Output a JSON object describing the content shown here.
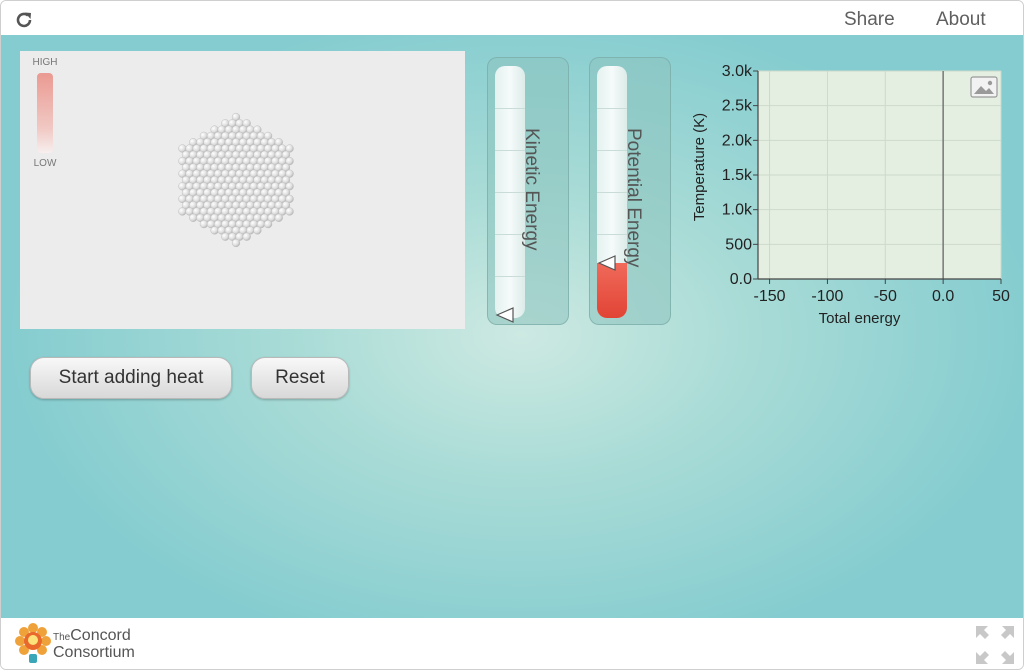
{
  "toolbar": {
    "reload_icon": "reload-icon",
    "share_label": "Share",
    "about_label": "About"
  },
  "thermometer": {
    "high_label": "HIGH",
    "low_label": "LOW"
  },
  "bars": {
    "kinetic": {
      "label": "Kinetic Energy",
      "level": 0.0
    },
    "potential": {
      "label": "Potential Energy",
      "level": 0.22
    }
  },
  "buttons": {
    "start_label": "Start adding heat",
    "reset_label": "Reset"
  },
  "footer": {
    "logo_the": "The",
    "logo_line1": "Concord",
    "logo_line2": "Consortium",
    "fullscreen_icon": "fullscreen-icon"
  },
  "colors": {
    "accent_red": "#e14435",
    "panel_teal": "#84ccd0"
  },
  "chart_data": {
    "type": "line",
    "xlabel": "Total energy",
    "ylabel": "Temperature (K)",
    "xlim": [
      -160,
      50
    ],
    "ylim": [
      0,
      3000
    ],
    "x_ticks": [
      -150,
      -100,
      -50,
      0.0,
      50
    ],
    "x_tick_labels": [
      "-150",
      "-100",
      "-50",
      "0.0",
      "50"
    ],
    "y_ticks": [
      0,
      500,
      1000,
      1500,
      2000,
      2500,
      3000
    ],
    "y_tick_labels": [
      "0.0",
      "500",
      "1.0k",
      "1.5k",
      "2.0k",
      "2.5k",
      "3.0k"
    ],
    "grid": true,
    "marker_x": 0,
    "series": [],
    "snapshot_icon": "image-icon"
  }
}
